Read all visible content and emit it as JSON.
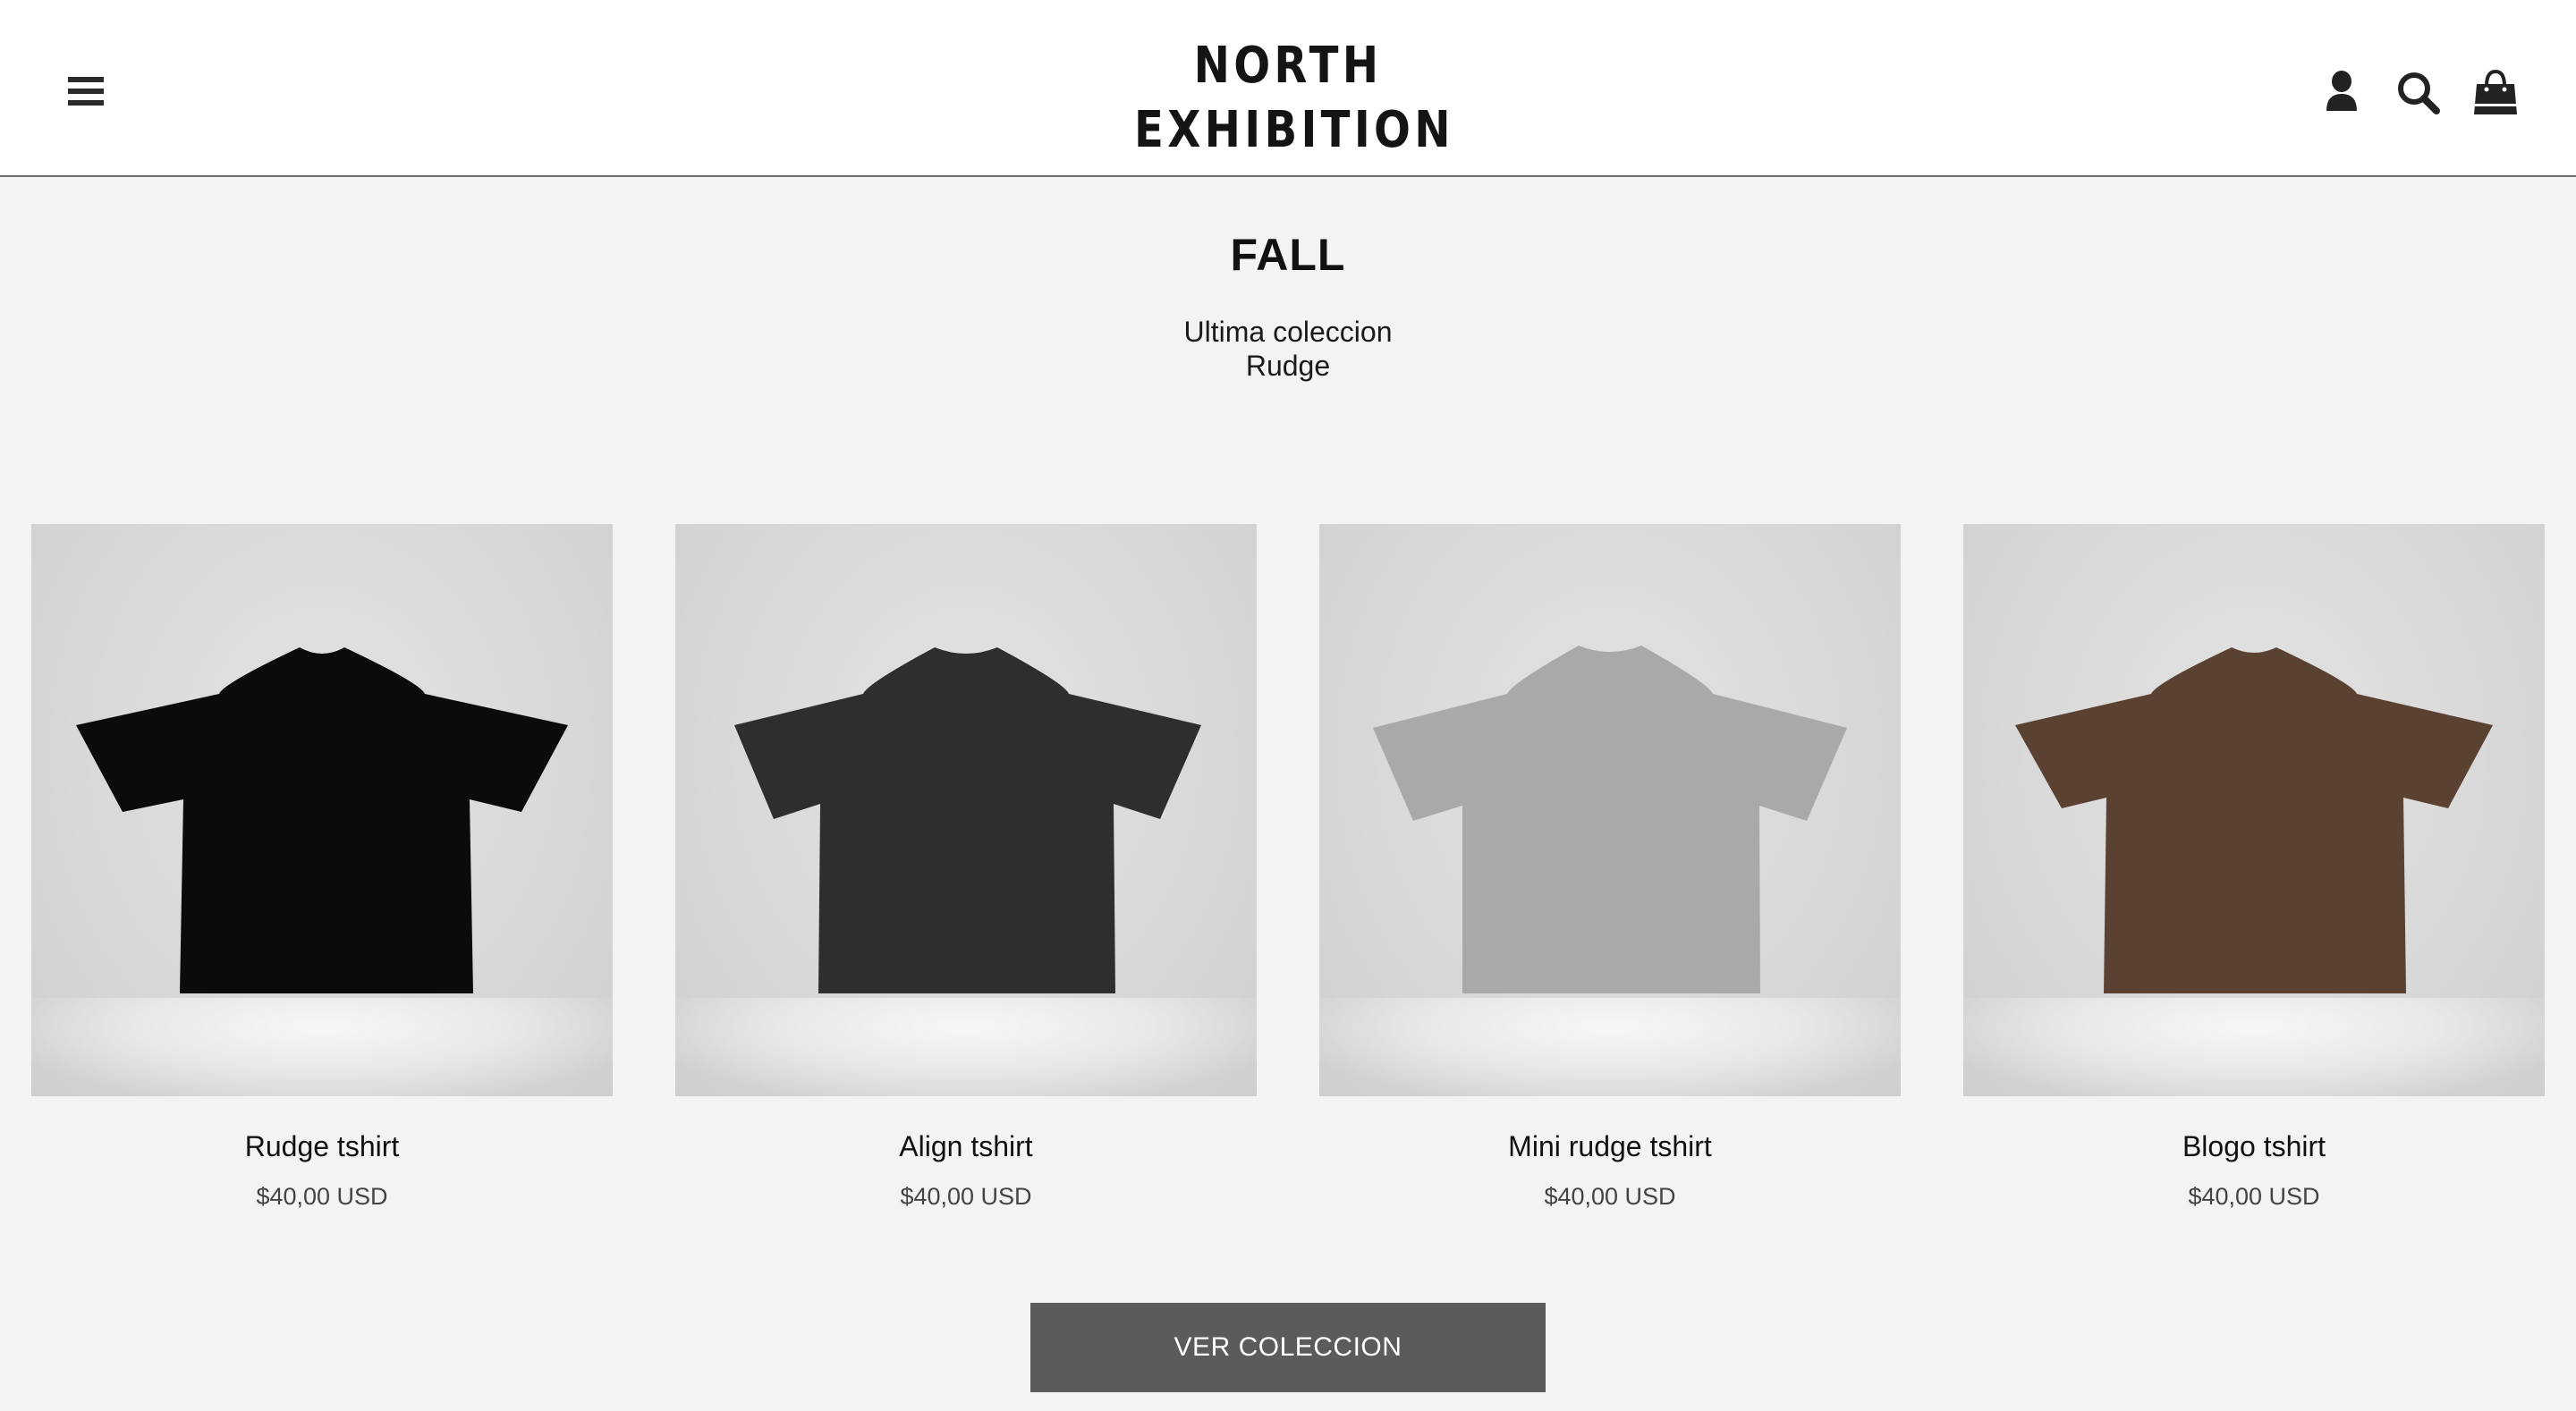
{
  "header": {
    "logo_line1": "NORTH",
    "logo_line2": "EXHIBITION",
    "icons": [
      "menu-icon",
      "account-icon",
      "search-icon",
      "cart-icon"
    ]
  },
  "collection": {
    "title": "FALL",
    "subtitle_line1": "Ultima coleccion",
    "subtitle_line2": "Rudge"
  },
  "products": [
    {
      "name": "Rudge tshirt",
      "price": "$40,00 USD",
      "shirt_color": "#0b0b0b"
    },
    {
      "name": "Align tshirt",
      "price": "$40,00 USD",
      "shirt_color": "#2e2e2e"
    },
    {
      "name": "Mini rudge tshirt",
      "price": "$40,00 USD",
      "shirt_color": "#a9a9a9"
    },
    {
      "name": "Blogo tshirt",
      "price": "$40,00 USD",
      "shirt_color": "#5a4132"
    }
  ],
  "cta": {
    "label": "VER COLECCION"
  },
  "colors": {
    "button_bg": "#5b5b5b",
    "page_bg": "#f3f3f3"
  }
}
